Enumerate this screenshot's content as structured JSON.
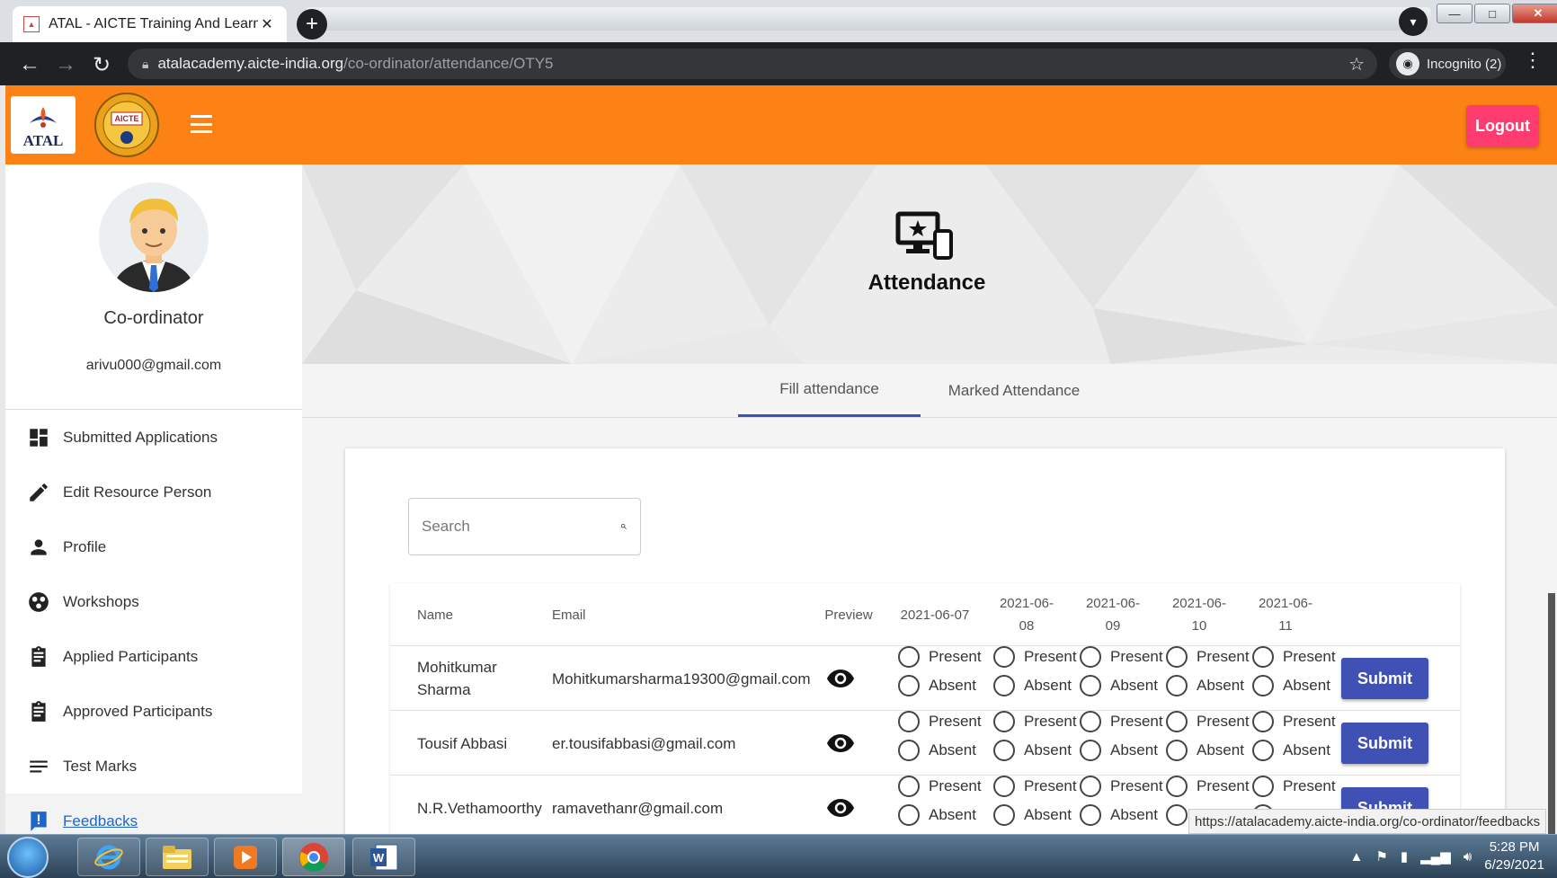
{
  "browser": {
    "tab_title": "ATAL - AICTE Training And Learn",
    "tab_close": "✕",
    "new_tab": "+",
    "url_host": "atalacademy.aicte-india.org",
    "url_path": "/co-ordinator/attendance/OTY5",
    "incognito_label": "Incognito (2)",
    "window_buttons": [
      "—",
      "□",
      "✕"
    ]
  },
  "header": {
    "atal_logo_text": "ATAL",
    "aicte_logo_text": "AICTE",
    "logout_label": "Logout",
    "colors": {
      "header_bg": "#fd8216",
      "logout_bg": "#ff3c70"
    }
  },
  "sidebar": {
    "role": "Co-ordinator",
    "email": "arivu000@gmail.com",
    "items": [
      {
        "label": "Submitted Applications",
        "icon": "dashboard-icon"
      },
      {
        "label": "Edit Resource Person",
        "icon": "pencil-icon"
      },
      {
        "label": "Profile",
        "icon": "person-icon"
      },
      {
        "label": "Workshops",
        "icon": "workspaces-icon"
      },
      {
        "label": "Applied Participants",
        "icon": "clipboard-icon"
      },
      {
        "label": "Approved Participants",
        "icon": "clipboard-icon"
      },
      {
        "label": "Test Marks",
        "icon": "list-icon"
      },
      {
        "label": "Feedbacks",
        "icon": "feedback-icon"
      }
    ]
  },
  "page": {
    "title": "Attendance",
    "tabs": [
      "Fill attendance",
      "Marked Attendance"
    ],
    "search_placeholder": "Search"
  },
  "table": {
    "headers": {
      "name": "Name",
      "email": "Email",
      "preview": "Preview",
      "dates": [
        "2021-06-07",
        "2021-06-08",
        "2021-06-09",
        "2021-06-10",
        "2021-06-11"
      ]
    },
    "present_label": "Present",
    "absent_label": "Absent",
    "submit_label": "Submit",
    "rows": [
      {
        "name": "Mohitkumar Sharma",
        "email": "Mohitkumarsharma19300@gmail.com"
      },
      {
        "name": "Tousif Abbasi",
        "email": "er.tousifabbasi@gmail.com"
      },
      {
        "name": "N.R.Vethamoorthy",
        "email": "ramavethanr@gmail.com"
      }
    ]
  },
  "status_bar_url": "https://atalacademy.aicte-india.org/co-ordinator/feedbacks",
  "taskbar": {
    "time": "5:28 PM",
    "date": "6/29/2021"
  }
}
